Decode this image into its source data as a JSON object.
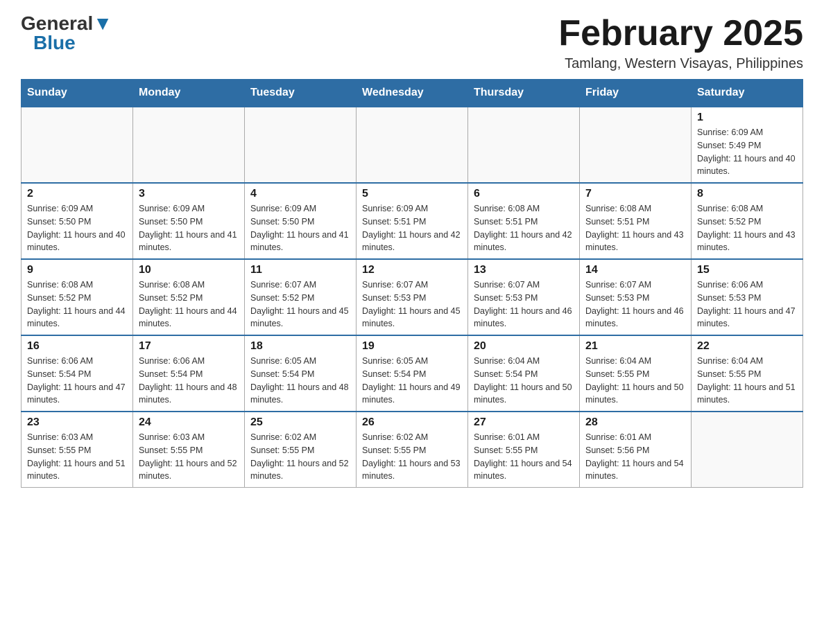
{
  "header": {
    "logo_general": "General",
    "logo_blue": "Blue",
    "title": "February 2025",
    "subtitle": "Tamlang, Western Visayas, Philippines"
  },
  "calendar": {
    "days_of_week": [
      "Sunday",
      "Monday",
      "Tuesday",
      "Wednesday",
      "Thursday",
      "Friday",
      "Saturday"
    ],
    "weeks": [
      [
        {
          "day": "",
          "info": ""
        },
        {
          "day": "",
          "info": ""
        },
        {
          "day": "",
          "info": ""
        },
        {
          "day": "",
          "info": ""
        },
        {
          "day": "",
          "info": ""
        },
        {
          "day": "",
          "info": ""
        },
        {
          "day": "1",
          "info": "Sunrise: 6:09 AM\nSunset: 5:49 PM\nDaylight: 11 hours and 40 minutes."
        }
      ],
      [
        {
          "day": "2",
          "info": "Sunrise: 6:09 AM\nSunset: 5:50 PM\nDaylight: 11 hours and 40 minutes."
        },
        {
          "day": "3",
          "info": "Sunrise: 6:09 AM\nSunset: 5:50 PM\nDaylight: 11 hours and 41 minutes."
        },
        {
          "day": "4",
          "info": "Sunrise: 6:09 AM\nSunset: 5:50 PM\nDaylight: 11 hours and 41 minutes."
        },
        {
          "day": "5",
          "info": "Sunrise: 6:09 AM\nSunset: 5:51 PM\nDaylight: 11 hours and 42 minutes."
        },
        {
          "day": "6",
          "info": "Sunrise: 6:08 AM\nSunset: 5:51 PM\nDaylight: 11 hours and 42 minutes."
        },
        {
          "day": "7",
          "info": "Sunrise: 6:08 AM\nSunset: 5:51 PM\nDaylight: 11 hours and 43 minutes."
        },
        {
          "day": "8",
          "info": "Sunrise: 6:08 AM\nSunset: 5:52 PM\nDaylight: 11 hours and 43 minutes."
        }
      ],
      [
        {
          "day": "9",
          "info": "Sunrise: 6:08 AM\nSunset: 5:52 PM\nDaylight: 11 hours and 44 minutes."
        },
        {
          "day": "10",
          "info": "Sunrise: 6:08 AM\nSunset: 5:52 PM\nDaylight: 11 hours and 44 minutes."
        },
        {
          "day": "11",
          "info": "Sunrise: 6:07 AM\nSunset: 5:52 PM\nDaylight: 11 hours and 45 minutes."
        },
        {
          "day": "12",
          "info": "Sunrise: 6:07 AM\nSunset: 5:53 PM\nDaylight: 11 hours and 45 minutes."
        },
        {
          "day": "13",
          "info": "Sunrise: 6:07 AM\nSunset: 5:53 PM\nDaylight: 11 hours and 46 minutes."
        },
        {
          "day": "14",
          "info": "Sunrise: 6:07 AM\nSunset: 5:53 PM\nDaylight: 11 hours and 46 minutes."
        },
        {
          "day": "15",
          "info": "Sunrise: 6:06 AM\nSunset: 5:53 PM\nDaylight: 11 hours and 47 minutes."
        }
      ],
      [
        {
          "day": "16",
          "info": "Sunrise: 6:06 AM\nSunset: 5:54 PM\nDaylight: 11 hours and 47 minutes."
        },
        {
          "day": "17",
          "info": "Sunrise: 6:06 AM\nSunset: 5:54 PM\nDaylight: 11 hours and 48 minutes."
        },
        {
          "day": "18",
          "info": "Sunrise: 6:05 AM\nSunset: 5:54 PM\nDaylight: 11 hours and 48 minutes."
        },
        {
          "day": "19",
          "info": "Sunrise: 6:05 AM\nSunset: 5:54 PM\nDaylight: 11 hours and 49 minutes."
        },
        {
          "day": "20",
          "info": "Sunrise: 6:04 AM\nSunset: 5:54 PM\nDaylight: 11 hours and 50 minutes."
        },
        {
          "day": "21",
          "info": "Sunrise: 6:04 AM\nSunset: 5:55 PM\nDaylight: 11 hours and 50 minutes."
        },
        {
          "day": "22",
          "info": "Sunrise: 6:04 AM\nSunset: 5:55 PM\nDaylight: 11 hours and 51 minutes."
        }
      ],
      [
        {
          "day": "23",
          "info": "Sunrise: 6:03 AM\nSunset: 5:55 PM\nDaylight: 11 hours and 51 minutes."
        },
        {
          "day": "24",
          "info": "Sunrise: 6:03 AM\nSunset: 5:55 PM\nDaylight: 11 hours and 52 minutes."
        },
        {
          "day": "25",
          "info": "Sunrise: 6:02 AM\nSunset: 5:55 PM\nDaylight: 11 hours and 52 minutes."
        },
        {
          "day": "26",
          "info": "Sunrise: 6:02 AM\nSunset: 5:55 PM\nDaylight: 11 hours and 53 minutes."
        },
        {
          "day": "27",
          "info": "Sunrise: 6:01 AM\nSunset: 5:55 PM\nDaylight: 11 hours and 54 minutes."
        },
        {
          "day": "28",
          "info": "Sunrise: 6:01 AM\nSunset: 5:56 PM\nDaylight: 11 hours and 54 minutes."
        },
        {
          "day": "",
          "info": ""
        }
      ]
    ]
  }
}
